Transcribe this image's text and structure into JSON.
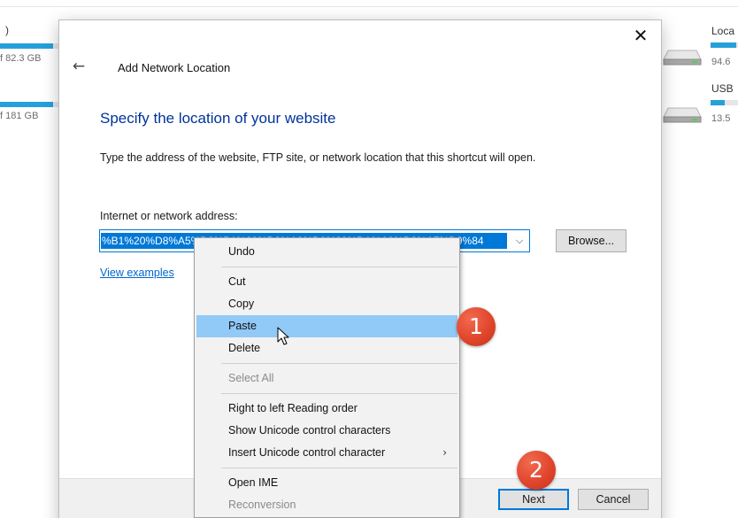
{
  "background": {
    "left_drive_1": {
      "name": ")",
      "size": "f 82.3 GB",
      "fill_fraction": 0.9
    },
    "left_drive_2": {
      "size": "f 181 GB",
      "fill_fraction": 0.9
    },
    "right_drive_1": {
      "name": "Loca",
      "size": "94.6",
      "fill_fraction": 0.95
    },
    "right_drive_2": {
      "name": "USB",
      "size": "13.5",
      "fill_fraction": 0.5
    }
  },
  "dialog": {
    "title": "Add Network Location",
    "close_glyph": "✕",
    "back_glyph": "←",
    "heading": "Specify the location of your website",
    "instruction": "Type the address of the website, FTP site, or network location that this shortcut will open.",
    "address_label": "Internet or network address:",
    "address_value": "%B1%20%D8%A5%D8%B1%20%D8%A8%D9%88%DA%A9%D8%A7%D9%84",
    "browse_label": "Browse...",
    "view_examples": "View examples",
    "next_label": "Next",
    "cancel_label": "Cancel"
  },
  "context_menu": {
    "undo": "Undo",
    "cut": "Cut",
    "copy": "Copy",
    "paste": "Paste",
    "delete": "Delete",
    "select_all": "Select All",
    "rtl": "Right to left Reading order",
    "show_unicode": "Show Unicode control characters",
    "insert_unicode": "Insert Unicode control character",
    "open_ime": "Open IME",
    "reconversion": "Reconversion",
    "hovered_item": "Paste"
  },
  "annotations": {
    "step_1": "1",
    "step_2": "2",
    "color": "#e0462c"
  },
  "colors": {
    "accent": "#0078d7",
    "heading": "#003399",
    "menu_hover": "#91c9f7",
    "link": "#0066cc"
  }
}
